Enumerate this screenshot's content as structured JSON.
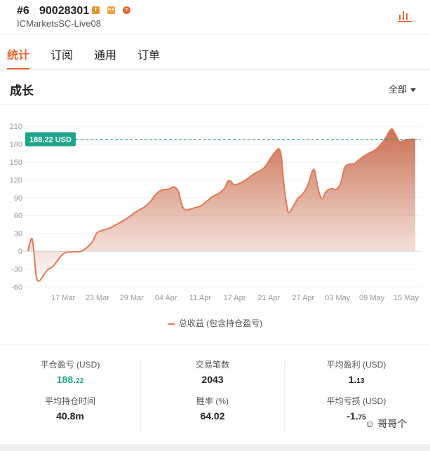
{
  "header": {
    "rank": "#6",
    "account": "90028301",
    "badges": [
      "T",
      "H-A",
      "Y"
    ],
    "server": "ICMarketsSC-Live08",
    "chart_icon": "bar-chart-icon"
  },
  "tabs": [
    "统计",
    "订阅",
    "通用",
    "订单"
  ],
  "growth": {
    "title": "成长",
    "range": "全部"
  },
  "chart_data": {
    "type": "area",
    "x_ticks": [
      "17 Mar",
      "23 Mar",
      "29 Mar",
      "04 Apr",
      "11 Apr",
      "17 Apr",
      "21 Apr",
      "27 Apr",
      "03 May",
      "09 May",
      "15 May"
    ],
    "y_ticks": [
      "210",
      "180",
      "150",
      "120",
      "90",
      "60",
      "30",
      "0",
      "-30",
      "-60"
    ],
    "ylim": [
      -60,
      210
    ],
    "series": [
      {
        "name": "总收益 (包含持仓盈亏)",
        "points": [
          [
            0,
            0
          ],
          [
            0.1,
            12
          ],
          [
            0.3,
            18
          ],
          [
            0.55,
            -42
          ],
          [
            0.75,
            -50
          ],
          [
            1.0,
            -42
          ],
          [
            1.3,
            -32
          ],
          [
            1.7,
            -25
          ],
          [
            2.0,
            -15
          ],
          [
            2.3,
            -6
          ],
          [
            2.6,
            -2
          ],
          [
            3.2,
            -1
          ],
          [
            3.6,
            0
          ],
          [
            3.9,
            5
          ],
          [
            4.3,
            15
          ],
          [
            4.6,
            30
          ],
          [
            5.0,
            35
          ],
          [
            5.4,
            38
          ],
          [
            5.8,
            43
          ],
          [
            6.3,
            50
          ],
          [
            6.8,
            58
          ],
          [
            7.3,
            67
          ],
          [
            7.8,
            74
          ],
          [
            8.2,
            83
          ],
          [
            8.6,
            96
          ],
          [
            9.0,
            103
          ],
          [
            9.4,
            104
          ],
          [
            9.8,
            108
          ],
          [
            10.1,
            100
          ],
          [
            10.3,
            80
          ],
          [
            10.5,
            70
          ],
          [
            10.8,
            70
          ],
          [
            11.2,
            73
          ],
          [
            11.6,
            76
          ],
          [
            12.0,
            84
          ],
          [
            12.4,
            92
          ],
          [
            12.8,
            97
          ],
          [
            13.2,
            106
          ],
          [
            13.4,
            117
          ],
          [
            13.6,
            118
          ],
          [
            13.8,
            112
          ],
          [
            14.1,
            113
          ],
          [
            14.5,
            118
          ],
          [
            14.9,
            125
          ],
          [
            15.3,
            132
          ],
          [
            15.7,
            137
          ],
          [
            16.0,
            145
          ],
          [
            16.3,
            157
          ],
          [
            16.6,
            167
          ],
          [
            16.85,
            172
          ],
          [
            17.0,
            160
          ],
          [
            17.15,
            120
          ],
          [
            17.35,
            80
          ],
          [
            17.5,
            65
          ],
          [
            17.8,
            75
          ],
          [
            18.1,
            88
          ],
          [
            18.5,
            98
          ],
          [
            18.8,
            112
          ],
          [
            19.1,
            135
          ],
          [
            19.25,
            135
          ],
          [
            19.4,
            115
          ],
          [
            19.55,
            98
          ],
          [
            19.75,
            88
          ],
          [
            19.95,
            98
          ],
          [
            20.2,
            104
          ],
          [
            20.45,
            105
          ],
          [
            20.7,
            104
          ],
          [
            21.0,
            115
          ],
          [
            21.25,
            140
          ],
          [
            21.55,
            146
          ],
          [
            21.9,
            147
          ],
          [
            22.2,
            153
          ],
          [
            22.5,
            159
          ],
          [
            22.9,
            165
          ],
          [
            23.3,
            170
          ],
          [
            23.7,
            180
          ],
          [
            24.0,
            190
          ],
          [
            24.25,
            201
          ],
          [
            24.45,
            205
          ],
          [
            24.7,
            195
          ],
          [
            24.95,
            184
          ],
          [
            25.2,
            186
          ],
          [
            25.6,
            188
          ],
          [
            26.0,
            188.22
          ]
        ]
      }
    ],
    "current_value_label": "188.22 USD",
    "current_value": 188.22,
    "line_color": "#e07a55",
    "fill_color_top": "#c86a4a",
    "guide_color": "#1fa58a"
  },
  "stats": {
    "closed_pnl": {
      "label": "平仓盈亏 (USD)",
      "value_main": "188.",
      "value_small": "22"
    },
    "trades": {
      "label": "交易笔数",
      "value": "2043"
    },
    "avg_profit": {
      "label": "平均盈利 (USD)",
      "value_main": "1.",
      "value_small": "13"
    },
    "avg_hold": {
      "label": "平均持仓时间",
      "value": "40.8m"
    },
    "win_rate": {
      "label": "胜率 (%)",
      "value": "64.02"
    },
    "avg_loss": {
      "label": "平均亏损 (USD)",
      "value_main": "-1.",
      "value_small": "75"
    }
  },
  "watermark": "哥哥个"
}
